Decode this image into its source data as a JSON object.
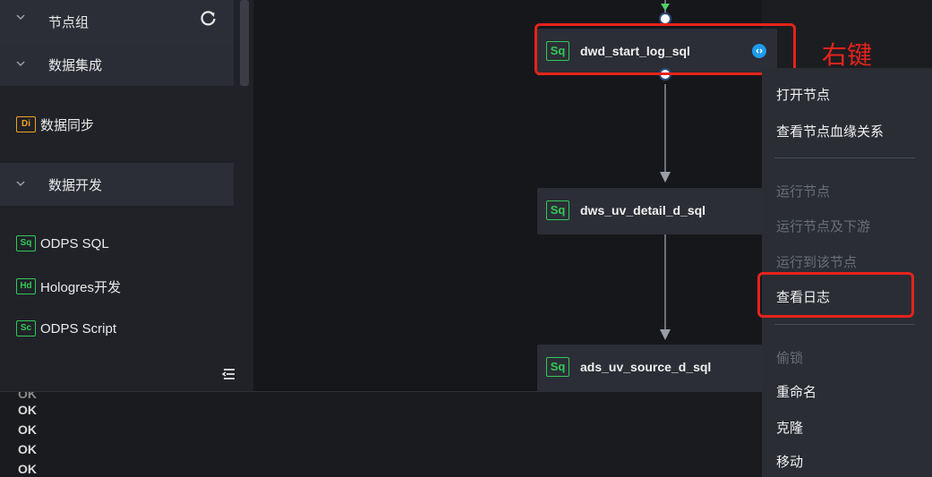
{
  "sidebar": {
    "node_group": "节点组",
    "data_integration": "数据集成",
    "data_sync": "数据同步",
    "data_dev": "数据开发",
    "items": [
      {
        "icon": "Sq",
        "label": "ODPS SQL"
      },
      {
        "icon": "Hd",
        "label": "Hologres开发"
      },
      {
        "icon": "Sc",
        "label": "ODPS Script"
      }
    ],
    "di_icon": "Di"
  },
  "canvas": {
    "nodes": [
      {
        "icon": "Sq",
        "label": "dwd_start_log_sql"
      },
      {
        "icon": "Sq",
        "label": "dws_uv_detail_d_sql"
      },
      {
        "icon": "Sq",
        "label": "ads_uv_source_d_sql"
      }
    ],
    "annotation": "右键"
  },
  "context_menu": {
    "open_node": "打开节点",
    "view_lineage": "查看节点血缘关系",
    "run_node": "运行节点",
    "run_downstream": "运行节点及下游",
    "run_to_node": "运行到该节点",
    "view_log": "查看日志",
    "lock": "偷锁",
    "rename": "重命名",
    "clone": "克隆",
    "move": "移动"
  },
  "log": {
    "lines": [
      "OK",
      "OK",
      "OK",
      "OK"
    ]
  },
  "colors": {
    "accent_green": "#34c85a",
    "accent_red": "#e5231b",
    "run_blue": "#1e9bf0"
  }
}
